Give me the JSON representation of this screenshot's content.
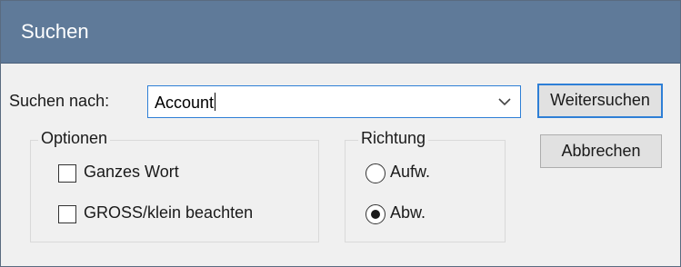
{
  "dialog": {
    "title": "Suchen"
  },
  "search": {
    "label": "Suchen nach:",
    "value": "Account"
  },
  "buttons": {
    "find_next": "Weitersuchen",
    "cancel": "Abbrechen"
  },
  "options": {
    "title": "Optionen",
    "whole_word": {
      "label": "Ganzes Wort",
      "checked": false
    },
    "match_case": {
      "label": "GROSS/klein beachten",
      "checked": false
    }
  },
  "direction": {
    "title": "Richtung",
    "up": {
      "label": "Aufw.",
      "selected": false
    },
    "down": {
      "label": "Abw.",
      "selected": true
    }
  },
  "icons": {
    "dropdown": "chevron-down-icon"
  },
  "colors": {
    "title_bar": "#5f7a99",
    "focus_accent": "#2e7fd6",
    "dialog_bg": "#f0f0f0"
  }
}
